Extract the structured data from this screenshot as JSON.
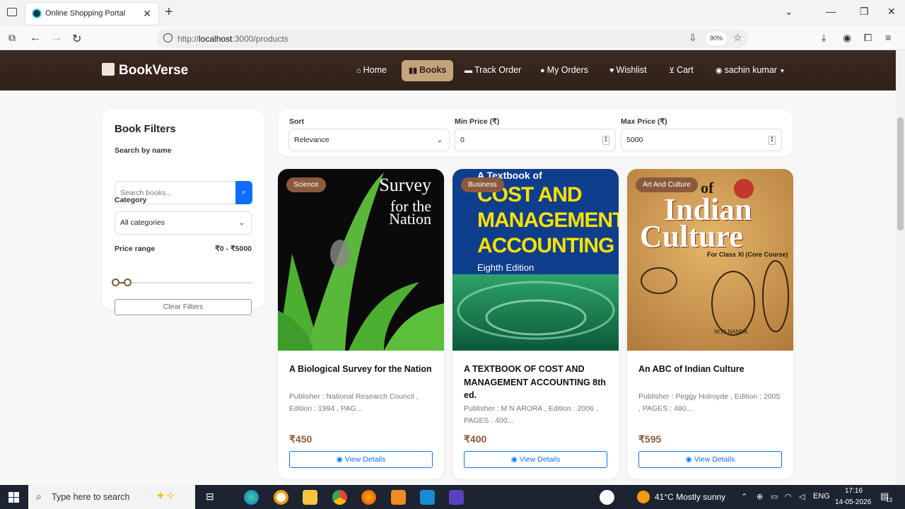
{
  "browser": {
    "tab_title": "Online Shopping Portal",
    "url_prefix": "http://",
    "url_host": "localhost",
    "url_rest": ":3000/products",
    "zoom": "90%"
  },
  "header": {
    "brand": "BookVerse",
    "nav": [
      {
        "label": "Home",
        "icon": "home-icon"
      },
      {
        "label": "Books",
        "icon": "book-icon"
      },
      {
        "label": "Track Order",
        "icon": "truck-icon"
      },
      {
        "label": "My Orders",
        "icon": "user-icon"
      },
      {
        "label": "Wishlist",
        "icon": "heart-icon"
      },
      {
        "label": "Cart",
        "icon": "cart-icon"
      },
      {
        "label": "sachin kumar",
        "icon": "user-circle-icon"
      }
    ]
  },
  "filters": {
    "title": "Book Filters",
    "search_label": "Search by name",
    "search_placeholder": "Search books...",
    "category_label": "Category",
    "category_value": "All categories",
    "price_label": "Price range",
    "price_value": "₹0 - ₹5000",
    "clear_label": "Clear Filters"
  },
  "sort": {
    "sort_label": "Sort",
    "sort_value": "Relevance",
    "min_label": "Min Price (₹)",
    "min_value": "0",
    "max_label": "Max Price (₹)",
    "max_value": "5000"
  },
  "books": [
    {
      "category": "Science",
      "title": "A Biological Survey for the Nation",
      "desc": "Publisher : National Research Council , Edition : 1994 , PAG...",
      "price": "₹450",
      "cover_text": [
        "Survey",
        "for the Nation"
      ]
    },
    {
      "category": "Business",
      "title": "A TEXTBOOK OF COST AND MANAGEMENT ACCOUNTING 8th ed.",
      "desc": "Publisher : M N ARORA , Edition : 2006 , PAGES : 400...",
      "price": "₹400",
      "cover_text": [
        "A Textbook of",
        "COST AND",
        "MANAGEMENT",
        "ACCOUNTING",
        "Eighth Edition"
      ]
    },
    {
      "category": "Art And Culture",
      "title": "An ABC of Indian Culture",
      "desc": "Publisher : Peggy Holroyde , Edition : 2005 , PAGES : 480...",
      "price": "₹595",
      "cover_text": [
        "of",
        "Indian",
        "Culture",
        "For Class XI (Core Course)",
        "NITA NANDA"
      ]
    }
  ],
  "view_details": "View Details",
  "taskbar": {
    "search_placeholder": "Type here to search",
    "weather": "41°C  Mostly sunny",
    "lang": "ENG",
    "time": "17:16",
    "date": "14-05-2026",
    "notifications": "13"
  }
}
